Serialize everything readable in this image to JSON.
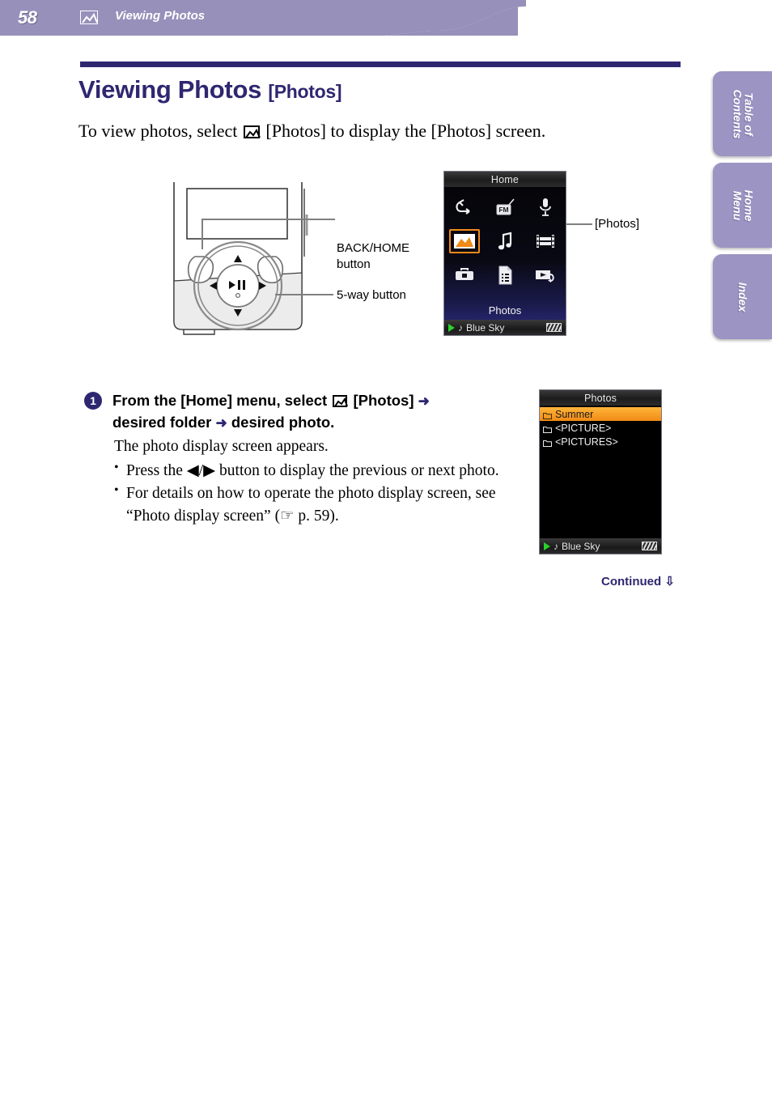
{
  "header": {
    "page_number": "58",
    "icon": "photo-icon",
    "title": "Viewing Photos",
    "bar_color": "#9690ba"
  },
  "side_tabs": [
    {
      "label": "Table of\nContents",
      "name": "table-of-contents"
    },
    {
      "label": "Home\nMenu",
      "name": "home-menu"
    },
    {
      "label": "Index",
      "name": "index"
    }
  ],
  "title_block": {
    "heading_main": "Viewing Photos ",
    "heading_sub": "[Photos]",
    "rule_color": "#2e2770",
    "intro_before": "To view photos, select ",
    "intro_after": " [Photos] to display the [Photos] screen."
  },
  "illustration": {
    "callouts": [
      {
        "name": "back-home-button",
        "text": "BACK/HOME\nbutton"
      },
      {
        "name": "five-way-button",
        "text": "5-way button"
      },
      {
        "name": "photos-callout",
        "text": "[Photos]"
      }
    ]
  },
  "home_screen": {
    "title": "Home",
    "selected_label": "Photos",
    "icons": [
      {
        "name": "shuffle-repeat-icon",
        "selected": false
      },
      {
        "name": "fm-radio-icon",
        "selected": false
      },
      {
        "name": "microphone-icon",
        "selected": false
      },
      {
        "name": "photo-icon",
        "selected": true
      },
      {
        "name": "music-note-icon",
        "selected": false
      },
      {
        "name": "film-video-icon",
        "selected": false
      },
      {
        "name": "toolbox-settings-icon",
        "selected": false
      },
      {
        "name": "playlist-document-icon",
        "selected": false
      },
      {
        "name": "playback-resume-icon",
        "selected": false
      }
    ],
    "status": {
      "track": "Blue Sky",
      "play_state": "playing",
      "battery": "full"
    }
  },
  "photos_screen": {
    "title": "Photos",
    "items": [
      {
        "label": "Summer",
        "selected": true
      },
      {
        "label": "<PICTURE>",
        "selected": false
      },
      {
        "label": "<PICTURES>",
        "selected": false
      }
    ],
    "status": {
      "track": "Blue Sky",
      "play_state": "playing",
      "battery": "full"
    }
  },
  "step": {
    "number": "1",
    "head_part1": "From the [Home] menu, select ",
    "head_part2": " [Photos] ",
    "head_part3": "desired folder ",
    "head_part4": "desired photo.",
    "arrow": "➜",
    "body_intro": "The photo display screen appears.",
    "bullets": [
      "Press the ◀/▶ button to display the previous or next photo.",
      "For details on how to operate the photo display screen, see “Photo display screen” (☞ p. 59)."
    ]
  },
  "footer": {
    "continued": "Continued",
    "continued_arrow": "⇩"
  }
}
